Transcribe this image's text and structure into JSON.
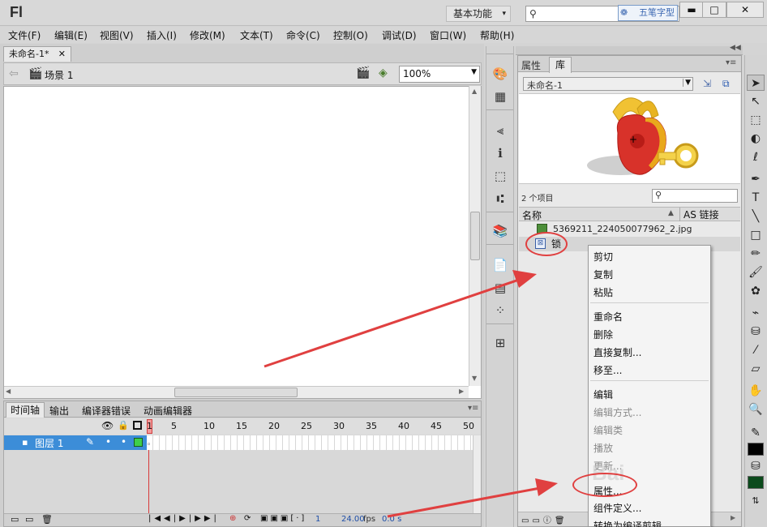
{
  "app": {
    "logo": "Fl",
    "workspace": "基本功能",
    "ime_label": "五笔字型"
  },
  "window_controls": {
    "minimize": "▬",
    "maximize": "□",
    "close": "✕"
  },
  "menu": [
    "文件(F)",
    "编辑(E)",
    "视图(V)",
    "插入(I)",
    "修改(M)",
    "文本(T)",
    "命令(C)",
    "控制(O)",
    "调试(D)",
    "窗口(W)",
    "帮助(H)"
  ],
  "document": {
    "tab_label": "未命名-1*",
    "scene": "场景 1",
    "zoom": "100%"
  },
  "timeline": {
    "tabs": [
      "时间轴",
      "输出",
      "编译器错误",
      "动画编辑器"
    ],
    "frame_ticks": [
      "1",
      "5",
      "10",
      "15",
      "20",
      "25",
      "30",
      "35",
      "40",
      "45",
      "50"
    ],
    "layer_name": "图层 1",
    "current_frame": "1",
    "fps": "24.00",
    "fps_unit": "fps",
    "elapsed": "0.0 s"
  },
  "panels": {
    "properties_tab": "属性",
    "library_tab": "库"
  },
  "library": {
    "document": "未命名-1",
    "item_count": "2 个项目",
    "col_name": "名称",
    "col_linkage": "AS 链接",
    "items": [
      {
        "name": "5369211_224050077962_2.jpg",
        "icon": "bitmap-icon"
      },
      {
        "name": "锁",
        "icon": "graphic-symbol-icon"
      }
    ]
  },
  "context_menu": {
    "items": [
      {
        "label": "剪切",
        "disabled": false
      },
      {
        "label": "复制",
        "disabled": false
      },
      {
        "label": "粘贴",
        "disabled": false
      },
      {
        "label": "重命名",
        "disabled": false
      },
      {
        "label": "删除",
        "disabled": false
      },
      {
        "label": "直接复制...",
        "disabled": false
      },
      {
        "label": "移至...",
        "disabled": false
      },
      {
        "label": "编辑",
        "disabled": false
      },
      {
        "label": "编辑方式...",
        "disabled": true
      },
      {
        "label": "编辑类",
        "disabled": true
      },
      {
        "label": "播放",
        "disabled": true
      },
      {
        "label": "更新...",
        "disabled": true
      },
      {
        "label": "属性...",
        "disabled": false
      },
      {
        "label": "组件定义...",
        "disabled": false
      },
      {
        "label": "转换为编译剪辑",
        "disabled": false
      }
    ]
  },
  "annotation": {
    "color": "#e04040"
  },
  "watermark": "Bai"
}
